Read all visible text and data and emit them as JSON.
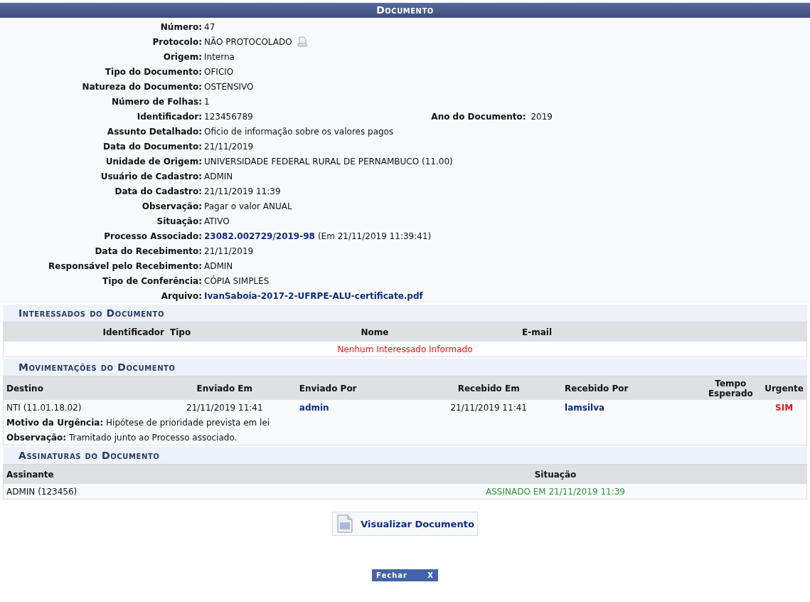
{
  "title": "Documento",
  "fields": [
    {
      "label": "Número:",
      "value": "47"
    },
    {
      "label": "Protocolo:",
      "value": "NÃO PROTOCOLADO",
      "icon": true
    },
    {
      "label": "Origem:",
      "value": "Interna"
    },
    {
      "label": "Tipo do Documento:",
      "value": "OFICIO"
    },
    {
      "label": "Natureza do Documento:",
      "value": "OSTENSIVO"
    },
    {
      "label": "Número de Folhas:",
      "value": "1"
    },
    {
      "label": "Identificador:",
      "value": "123456789",
      "extra_label": "Ano do Documento:",
      "extra_value": "2019"
    },
    {
      "label": "Assunto Detalhado:",
      "value": "Oficio de informação sobre os valores pagos"
    },
    {
      "label": "Data do Documento:",
      "value": "21/11/2019"
    },
    {
      "label": "Unidade de Origem:",
      "value": "UNIVERSIDADE FEDERAL RURAL DE PERNAMBUCO (11.00)"
    },
    {
      "label": "Usuário de Cadastro:",
      "value": "ADMIN"
    },
    {
      "label": "Data do Cadastro:",
      "value": "21/11/2019 11:39"
    },
    {
      "label": "Observação:",
      "value": "Pagar o valor ANUAL"
    },
    {
      "label": "Situação:",
      "value": "ATIVO"
    },
    {
      "label": "Processo Associado:",
      "value": "23082.002729/2019-98",
      "kind": "link",
      "suffix": "(Em 21/11/2019 11:39:41)"
    },
    {
      "label": "Data do Recebimento:",
      "value": "21/11/2019"
    },
    {
      "label": "Responsável pelo Recebimento:",
      "value": "ADMIN"
    },
    {
      "label": "Tipo de Conferência:",
      "value": "CÓPIA SIMPLES"
    },
    {
      "label": "Arquivo:",
      "value": "IvanSaboia-2017-2-UFRPE-ALU-certificate.pdf",
      "kind": "link"
    }
  ],
  "interessados": {
    "title": "Interessados do Documento",
    "columns": [
      "Identificador",
      "Tipo",
      "Nome",
      "E-mail"
    ],
    "empty": "Nenhum Interessado Informado"
  },
  "movimentacoes": {
    "title": "Movimentações do Documento",
    "columns": [
      "Destino",
      "Enviado Em",
      "Enviado Por",
      "Recebido Em",
      "Recebido Por",
      "Tempo Esperado",
      "Urgente"
    ],
    "rows": [
      {
        "destino": "NTI (11.01.18.02)",
        "enviado_em": "21/11/2019 11:41",
        "enviado_por": "admin",
        "recebido_em": "21/11/2019 11:41",
        "recebido_por": "lamsilva",
        "urgente": "SIM",
        "notes": [
          {
            "label": "Motivo da Urgência:",
            "value": "Hipótese de prioridade prevista em lei"
          },
          {
            "label": "Observação:",
            "value": "Tramitado junto ao Processo associado."
          }
        ]
      }
    ]
  },
  "assinaturas": {
    "title": "Assinaturas do Documento",
    "columns": [
      "Assinante",
      "Situação"
    ],
    "rows": [
      {
        "assinante": "ADMIN (123456)",
        "situacao": "ASSINADO EM 21/11/2019 11:39"
      }
    ]
  },
  "view_button": "Visualizar Documento",
  "close_button": {
    "label": "Fechar",
    "icon": "X"
  }
}
